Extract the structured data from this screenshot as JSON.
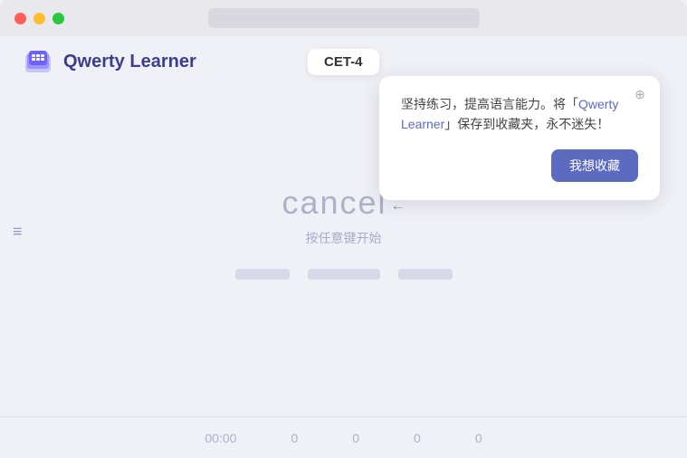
{
  "browser": {
    "traffic_lights": [
      "red",
      "yellow",
      "green"
    ]
  },
  "navbar": {
    "logo_alt": "Qwerty Learner logo",
    "app_title": "Qwerty Learner",
    "cet_badge": "CET-4"
  },
  "tooltip": {
    "text_part1": "坚持练习，提高语言能力。将「",
    "highlight": "Qwerty Learner",
    "text_part2": "」保存到收藏夹，永不迷失！",
    "bookmark_button": "我想收藏",
    "close_icon": "⊕"
  },
  "main": {
    "typing_word": "cancel",
    "typing_cursor": "←",
    "start_hint": "按任意键开始"
  },
  "bottom_bar": {
    "stats": [
      {
        "value": "00:00",
        "label": ""
      },
      {
        "value": "0",
        "label": ""
      },
      {
        "value": "0",
        "label": ""
      },
      {
        "value": "0",
        "label": ""
      },
      {
        "value": "0",
        "label": ""
      }
    ]
  },
  "sidebar": {
    "menu_icon": "≡"
  }
}
